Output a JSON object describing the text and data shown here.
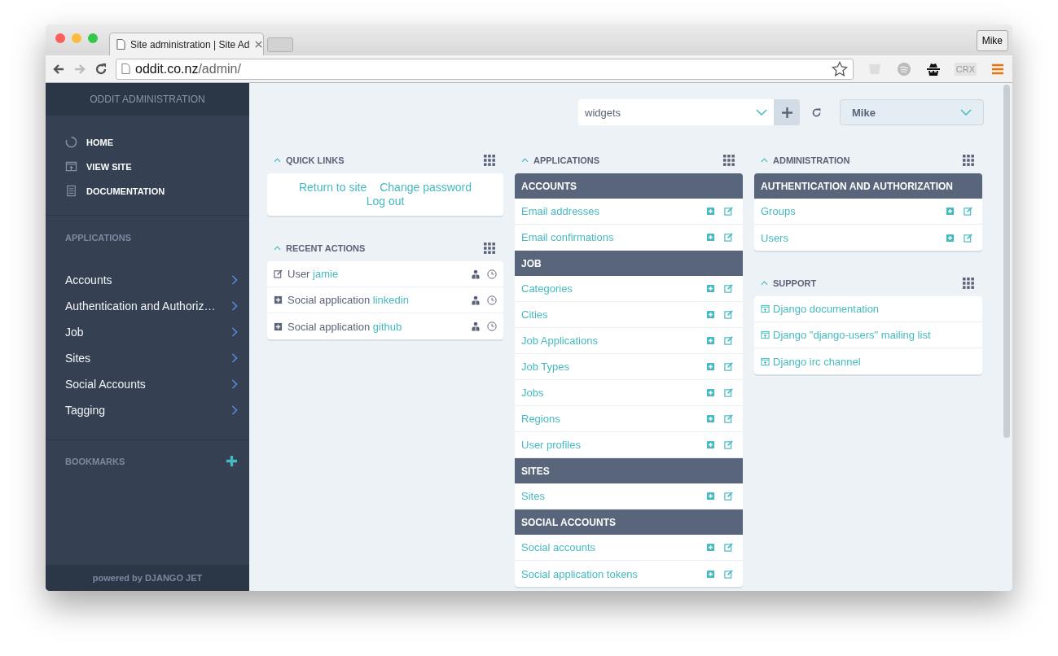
{
  "browser": {
    "tab_title": "Site administration | Site Ad",
    "profile": "Mike",
    "url_host": "oddit.co.nz",
    "url_path": "/admin/",
    "extension_label": "CRX"
  },
  "sidebar": {
    "title": "ODDIT ADMINISTRATION",
    "nav": [
      {
        "label": "HOME"
      },
      {
        "label": "VIEW SITE"
      },
      {
        "label": "DOCUMENTATION"
      }
    ],
    "applications_heading": "APPLICATIONS",
    "applications": [
      {
        "label": "Accounts"
      },
      {
        "label": "Authentication and Authoriz…"
      },
      {
        "label": "Job"
      },
      {
        "label": "Sites"
      },
      {
        "label": "Social Accounts"
      },
      {
        "label": "Tagging"
      }
    ],
    "bookmarks_heading": "BOOKMARKS",
    "footer_prefix": "powered by",
    "footer_brand": "DJANGO JET"
  },
  "toolbar": {
    "widgets_select": "widgets",
    "user_select": "Mike"
  },
  "quick_links": {
    "title": "QUICK LINKS",
    "links": [
      "Return to site",
      "Change password",
      "Log out"
    ]
  },
  "recent_actions": {
    "title": "RECENT ACTIONS",
    "items": [
      {
        "kind": "changed",
        "text": "User",
        "link": "jamie"
      },
      {
        "kind": "added",
        "text": "Social application",
        "link": "linkedin"
      },
      {
        "kind": "added",
        "text": "Social application",
        "link": "github"
      }
    ]
  },
  "applications": {
    "title": "APPLICATIONS",
    "groups": [
      {
        "name": "ACCOUNTS",
        "models": [
          "Email addresses",
          "Email confirmations"
        ]
      },
      {
        "name": "JOB",
        "models": [
          "Categories",
          "Cities",
          "Job Applications",
          "Job Types",
          "Jobs",
          "Regions",
          "User profiles"
        ]
      },
      {
        "name": "SITES",
        "models": [
          "Sites"
        ]
      },
      {
        "name": "SOCIAL ACCOUNTS",
        "models": [
          "Social accounts",
          "Social application tokens"
        ]
      }
    ]
  },
  "administration": {
    "title": "ADMINISTRATION",
    "groups": [
      {
        "name": "AUTHENTICATION AND AUTHORIZATION",
        "models": [
          "Groups",
          "Users"
        ]
      }
    ]
  },
  "support": {
    "title": "SUPPORT",
    "links": [
      "Django documentation",
      "Django \"django-users\" mailing list",
      "Django irc channel"
    ]
  }
}
